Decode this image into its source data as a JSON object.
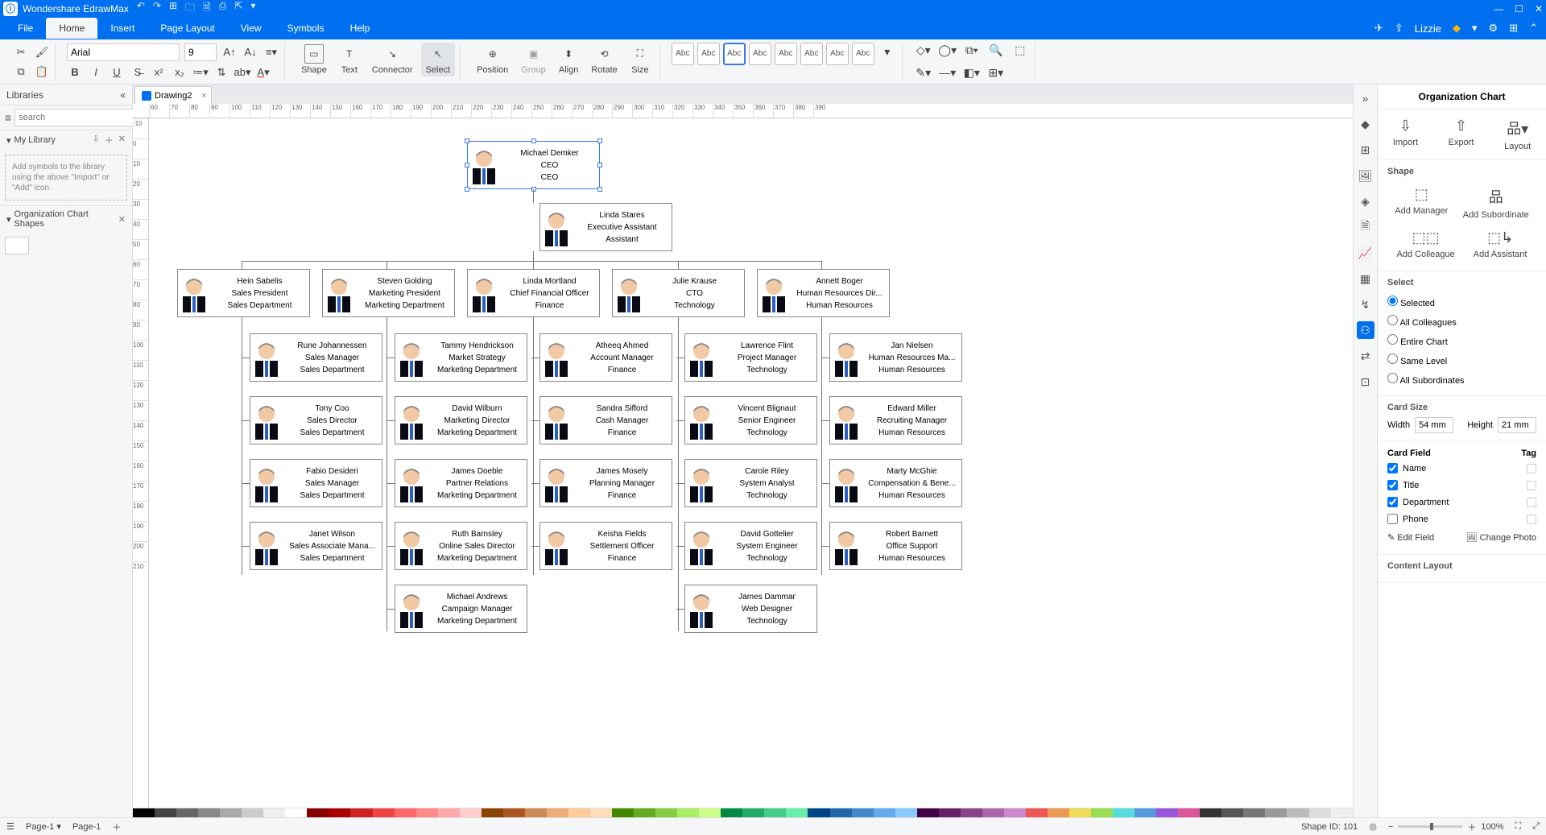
{
  "app": {
    "title": "Wondershare EdrawMax"
  },
  "menubar": {
    "file": "File",
    "home": "Home",
    "insert": "Insert",
    "pageLayout": "Page Layout",
    "view": "View",
    "symbols": "Symbols",
    "help": "Help",
    "user": "Lizzie"
  },
  "ribbon": {
    "font": "Arial",
    "fontSize": "9",
    "shape": "Shape",
    "text": "Text",
    "connector": "Connector",
    "select": "Select",
    "position": "Position",
    "group": "Group",
    "align": "Align",
    "rotate": "Rotate",
    "size": "Size",
    "themeLabel": "Abc"
  },
  "leftPanel": {
    "title": "Libraries",
    "searchPlaceholder": "search",
    "myLibrary": "My Library",
    "hint": "Add symbols to the library using the above \"Import\" or \"Add\" icon.",
    "orgShapes": "Organization Chart Shapes"
  },
  "docTabs": {
    "drawing": "Drawing2"
  },
  "rulerH": [
    "60",
    "70",
    "80",
    "90",
    "100",
    "110",
    "120",
    "130",
    "140",
    "150",
    "160",
    "170",
    "180",
    "190",
    "200",
    "210",
    "220",
    "230",
    "240",
    "250",
    "260",
    "270",
    "280",
    "290",
    "300",
    "310",
    "320",
    "330",
    "340",
    "350",
    "360",
    "370",
    "380",
    "390"
  ],
  "rulerV": [
    "-10",
    "0",
    "10",
    "20",
    "30",
    "40",
    "50",
    "60",
    "70",
    "80",
    "90",
    "100",
    "110",
    "120",
    "130",
    "140",
    "150",
    "160",
    "170",
    "180",
    "190",
    "200",
    "210"
  ],
  "org": {
    "ceo": {
      "name": "Michael Demker",
      "title": "CEO",
      "dept": "CEO"
    },
    "asst": {
      "name": "Linda Stares",
      "title": "Executive Assistant",
      "dept": "Assistant"
    },
    "m1": {
      "name": "Hein Sabelis",
      "title": "Sales President",
      "dept": "Sales Department"
    },
    "m2": {
      "name": "Steven Golding",
      "title": "Marketing President",
      "dept": "Marketing Department"
    },
    "m3": {
      "name": "Linda Mortland",
      "title": "Chief Financial Officer",
      "dept": "Finance"
    },
    "m4": {
      "name": "Julie Krause",
      "title": "CTO",
      "dept": "Technology"
    },
    "m5": {
      "name": "Annett Boger",
      "title": "Human Resources Dir...",
      "dept": "Human Resources"
    },
    "r1c1": {
      "name": "Rune Johannessen",
      "title": "Sales Manager",
      "dept": "Sales Department"
    },
    "r1c2": {
      "name": "Tammy Hendrickson",
      "title": "Market Strategy",
      "dept": "Marketing Department"
    },
    "r1c3": {
      "name": "Atheeq Ahmed",
      "title": "Account Manager",
      "dept": "Finance"
    },
    "r1c4": {
      "name": "Lawrence Flint",
      "title": "Project Manager",
      "dept": "Technology"
    },
    "r1c5": {
      "name": "Jan Nielsen",
      "title": "Human Resources Ma...",
      "dept": "Human Resources"
    },
    "r2c1": {
      "name": "Tony Coo",
      "title": "Sales Director",
      "dept": "Sales Department"
    },
    "r2c2": {
      "name": "David Wilburn",
      "title": "Marketing Director",
      "dept": "Marketing Department"
    },
    "r2c3": {
      "name": "Sandra Sifford",
      "title": "Cash Manager",
      "dept": "Finance"
    },
    "r2c4": {
      "name": "Vincent Blignaut",
      "title": "Senior Engineer",
      "dept": "Technology"
    },
    "r2c5": {
      "name": "Edward Miller",
      "title": "Recruiting Manager",
      "dept": "Human Resources"
    },
    "r3c1": {
      "name": "Fabio Desideri",
      "title": "Sales Manager",
      "dept": "Sales Department"
    },
    "r3c2": {
      "name": "James Doeble",
      "title": "Partner Relations",
      "dept": "Marketing Department"
    },
    "r3c3": {
      "name": "James Mosely",
      "title": "Planning Manager",
      "dept": "Finance"
    },
    "r3c4": {
      "name": "Carole Riley",
      "title": "System Analyst",
      "dept": "Technology"
    },
    "r3c5": {
      "name": "Marty McGhie",
      "title": "Compensation & Bene...",
      "dept": "Human Resources"
    },
    "r4c1": {
      "name": "Janet Wilson",
      "title": "Sales Associate Mana...",
      "dept": "Sales Department"
    },
    "r4c2": {
      "name": "Ruth Barnsley",
      "title": "Online Sales Director",
      "dept": "Marketing Department"
    },
    "r4c3": {
      "name": "Keisha Fields",
      "title": "Settlement Officer",
      "dept": "Finance"
    },
    "r4c4": {
      "name": "David Gottelier",
      "title": "System Engineer",
      "dept": "Technology"
    },
    "r4c5": {
      "name": "Robert Barnett",
      "title": "Office Support",
      "dept": "Human Resources"
    },
    "r5c2": {
      "name": "Michael Andrews",
      "title": "Campaign Manager",
      "dept": "Marketing Department"
    },
    "r5c4": {
      "name": "James Dammar",
      "title": "Web Designer",
      "dept": "Technology"
    }
  },
  "rightPanel": {
    "title": "Organization Chart",
    "import": "Import",
    "export": "Export",
    "layout": "Layout",
    "shapeHdr": "Shape",
    "addManager": "Add Manager",
    "addSubordinate": "Add Subordinate",
    "addColleague": "Add Colleague",
    "addAssistant": "Add Assistant",
    "selectHdr": "Select",
    "selSelected": "Selected",
    "selAllColleagues": "All Colleagues",
    "selEntire": "Entire Chart",
    "selSameLevel": "Same Level",
    "selAllSub": "All Subordinates",
    "cardSizeHdr": "Card Size",
    "widthLbl": "Width",
    "widthVal": "54 mm",
    "heightLbl": "Height",
    "heightVal": "21 mm",
    "cardField": "Card Field",
    "tag": "Tag",
    "fName": "Name",
    "fTitle": "Title",
    "fDept": "Department",
    "fPhone": "Phone",
    "editField": "Edit Field",
    "changePhoto": "Change Photo",
    "contentLayout": "Content Layout"
  },
  "status": {
    "page": "Page-1",
    "pageTab": "Page-1",
    "shapeId": "Shape ID: 101",
    "zoom": "100%"
  }
}
